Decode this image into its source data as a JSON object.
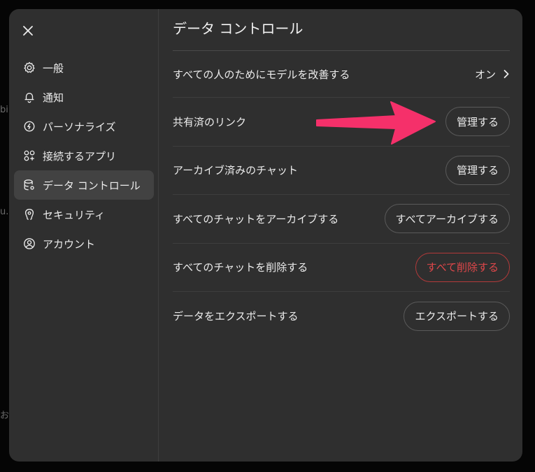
{
  "background_fragments": [
    "bi",
    "u.",
    "お"
  ],
  "sidebar": {
    "close_label": "✕",
    "items": [
      {
        "label": "一般",
        "icon": "gear-icon"
      },
      {
        "label": "通知",
        "icon": "bell-icon"
      },
      {
        "label": "パーソナライズ",
        "icon": "personalize-icon"
      },
      {
        "label": "接続するアプリ",
        "icon": "apps-icon"
      },
      {
        "label": "データ コントロール",
        "icon": "database-icon",
        "active": true
      },
      {
        "label": "セキュリティ",
        "icon": "security-icon"
      },
      {
        "label": "アカウント",
        "icon": "user-icon"
      }
    ]
  },
  "main": {
    "title": "データ コントロール",
    "rows": [
      {
        "label": "すべての人のためにモデルを改善する",
        "value": "オン"
      },
      {
        "label": "共有済のリンク",
        "button": "管理する"
      },
      {
        "label": "アーカイブ済みのチャット",
        "button": "管理する"
      },
      {
        "label": "すべてのチャットをアーカイブする",
        "button": "すべてアーカイブする"
      },
      {
        "label": "すべてのチャットを削除する",
        "button": "すべて削除する"
      },
      {
        "label": "データをエクスポートする",
        "button": "エクスポートする"
      }
    ]
  },
  "colors": {
    "dialog_bg": "#2f2f2f",
    "danger": "#e0474a",
    "annotation_arrow": "#f5306a"
  }
}
